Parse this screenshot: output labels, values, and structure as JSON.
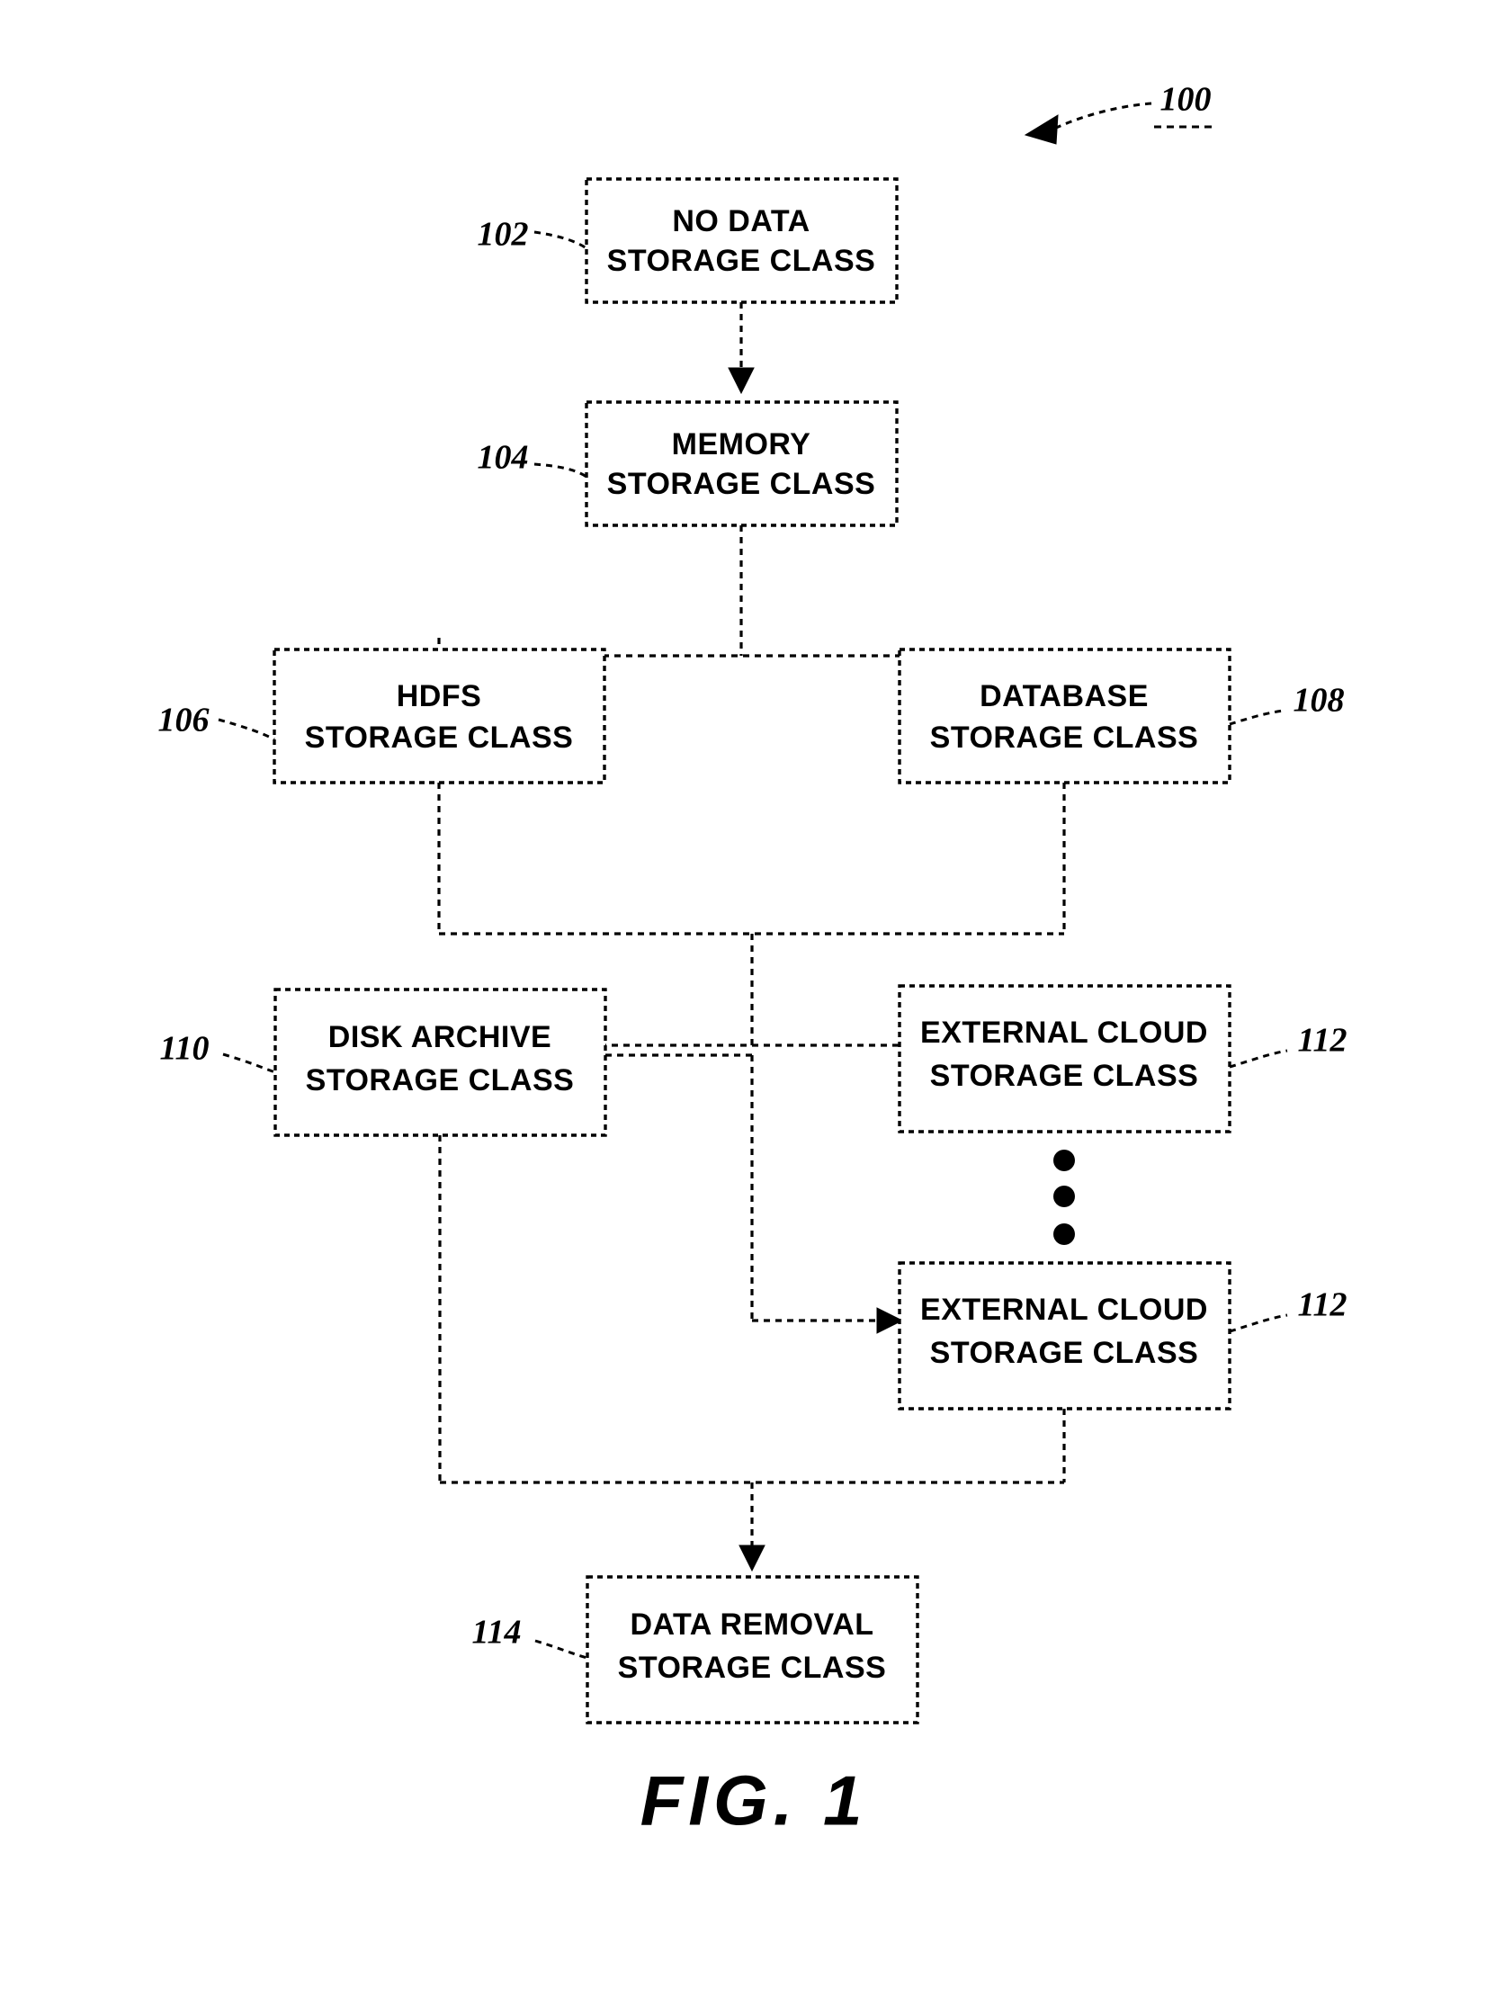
{
  "figure": {
    "caption": "FIG. 1",
    "diagram_number": "100"
  },
  "nodes": [
    {
      "id": "no-data",
      "ref": "102",
      "line1": "NO DATA",
      "line2": "STORAGE CLASS"
    },
    {
      "id": "memory",
      "ref": "104",
      "line1": "MEMORY",
      "line2": "STORAGE CLASS"
    },
    {
      "id": "hdfs",
      "ref": "106",
      "line1": "HDFS",
      "line2": "STORAGE CLASS"
    },
    {
      "id": "database",
      "ref": "108",
      "line1": "DATABASE",
      "line2": "STORAGE CLASS"
    },
    {
      "id": "disk-archive",
      "ref": "110",
      "line1": "DISK ARCHIVE",
      "line2": "STORAGE CLASS"
    },
    {
      "id": "external-cloud-1",
      "ref": "112",
      "line1": "EXTERNAL CLOUD",
      "line2": "STORAGE CLASS"
    },
    {
      "id": "external-cloud-2",
      "ref": "112",
      "line1": "EXTERNAL CLOUD",
      "line2": "STORAGE CLASS"
    },
    {
      "id": "data-removal",
      "ref": "114",
      "line1": "DATA REMOVAL",
      "line2": "STORAGE CLASS"
    }
  ],
  "ellipsis": {
    "label": "vertical-ellipsis",
    "dot_count": 3
  },
  "colors": {
    "ink": "#000000",
    "paper": "#ffffff"
  }
}
